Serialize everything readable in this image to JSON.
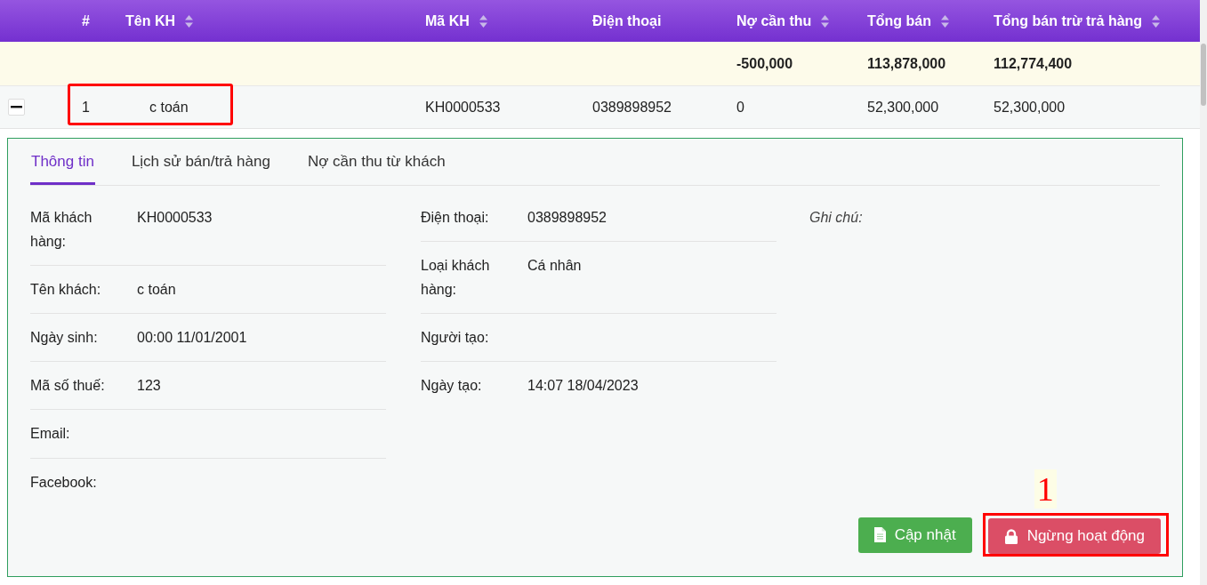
{
  "table": {
    "columns": [
      {
        "label": "#",
        "sortable": false
      },
      {
        "label": "Tên KH",
        "sortable": true
      },
      {
        "label": "Mã KH",
        "sortable": true
      },
      {
        "label": "Điện thoại",
        "sortable": false
      },
      {
        "label": "Nợ cần thu",
        "sortable": true
      },
      {
        "label": "Tổng bán",
        "sortable": true
      },
      {
        "label": "Tổng bán trừ trả hàng",
        "sortable": true
      }
    ],
    "summary_row": {
      "debt": "-500,000",
      "total_sales": "113,878,000",
      "net_sales": "112,774,400"
    },
    "rows": [
      {
        "expanded": true,
        "highlighted": true,
        "cells": [
          "1",
          "c toán",
          "KH0000533",
          "0389898952",
          "0",
          "52,300,000",
          "52,300,000"
        ]
      }
    ]
  },
  "detail": {
    "tabs": [
      {
        "label": "Thông tin",
        "selected": true
      },
      {
        "label": "Lịch sử bán/trả hàng",
        "selected": false
      },
      {
        "label": "Nợ cần thu từ khách",
        "selected": false
      }
    ],
    "columns": [
      [
        {
          "label": "Mã khách hàng:",
          "value": "KH0000533"
        },
        {
          "label": "Tên khách:",
          "value": "c toán"
        },
        {
          "label": "Ngày sinh:",
          "value": "00:00 11/01/2001"
        },
        {
          "label": "Mã số thuế:",
          "value": "123"
        },
        {
          "label": "Email:"
        },
        {
          "label": "Facebook:"
        }
      ],
      [
        {
          "label": "Điện thoại:",
          "value": "0389898952"
        },
        {
          "label": "Loại khách hàng:",
          "value": "Cá nhân"
        },
        {
          "label": "Người tạo:"
        },
        {
          "label": "Ngày tạo:",
          "value": "14:07 18/04/2023"
        }
      ]
    ],
    "note_label": "Ghi chú:",
    "buttons": [
      {
        "kind": "update",
        "label": "Cập nhật",
        "highlighted": false
      },
      {
        "kind": "deactivate",
        "label": "Ngừng hoạt động",
        "highlighted": true,
        "callout": "1"
      }
    ]
  }
}
